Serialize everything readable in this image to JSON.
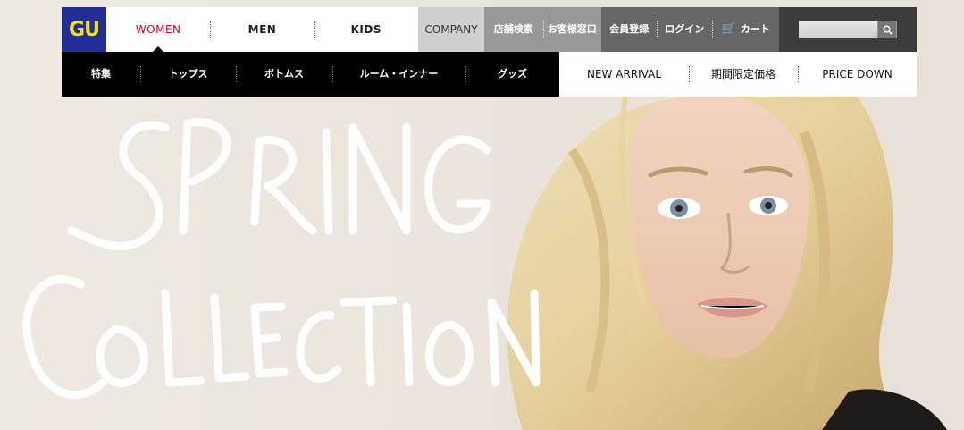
{
  "brand": {
    "logo_text": "GU",
    "logo_bg": "#1f2f95",
    "logo_fg": "#f3df1a"
  },
  "gender_nav": [
    {
      "label": "WOMEN",
      "active": true
    },
    {
      "label": "MEN",
      "active": false
    },
    {
      "label": "KIDS",
      "active": false
    }
  ],
  "company": {
    "label": "COMPANY"
  },
  "service_nav": [
    {
      "label": "店舗検索"
    },
    {
      "label": "お客様窓口"
    }
  ],
  "account_nav": [
    {
      "label": "会員登録"
    },
    {
      "label": "ログイン"
    },
    {
      "label": "カート",
      "icon": "cart-icon"
    }
  ],
  "search": {
    "placeholder": "",
    "icon": "search-icon"
  },
  "category_nav": [
    {
      "label": "特集"
    },
    {
      "label": "トップス"
    },
    {
      "label": "ボトムス"
    },
    {
      "label": "ルーム・インナー"
    },
    {
      "label": "グッズ"
    }
  ],
  "pick_nav": [
    {
      "label": "NEW ARRIVAL"
    },
    {
      "label": "期間限定価格"
    },
    {
      "label": "PRICE DOWN"
    }
  ],
  "hero": {
    "headline_line1": "SPRING",
    "headline_line2": "COLLECTION",
    "accent": "#d7001c"
  }
}
